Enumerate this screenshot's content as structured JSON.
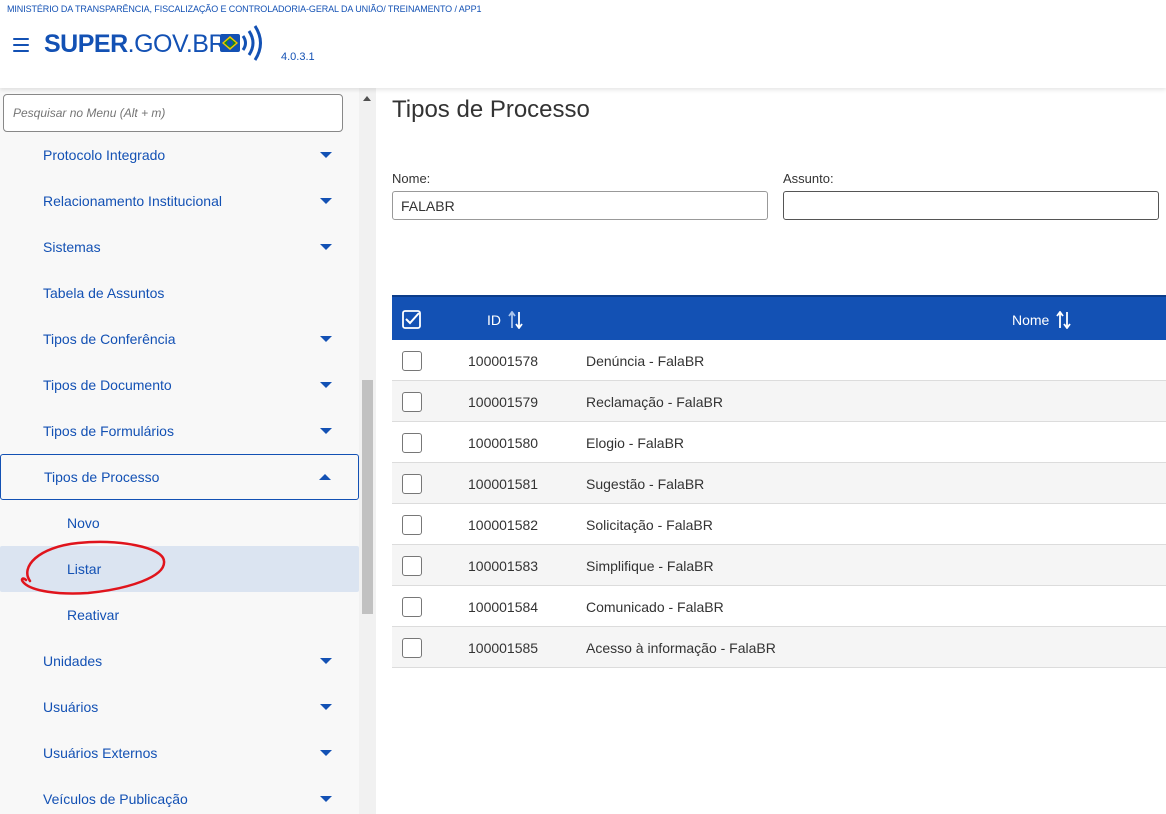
{
  "header": {
    "org_line": "MINISTÉRIO DA TRANSPARÊNCIA, FISCALIZAÇÃO E CONTROLADORIA-GERAL DA UNIÃO/ TREINAMENTO / APP1",
    "logo_bold": "SUPER",
    "logo_rest": ".GOV.BR",
    "version": "4.0.3.1",
    "hamburger_icon": "menu-icon",
    "accent_color": "#1351b4"
  },
  "sidebar": {
    "search_placeholder": "Pesquisar no Menu (Alt + m)",
    "items": [
      {
        "label": "Protocolo Integrado",
        "caret": "down"
      },
      {
        "label": "Relacionamento Institucional",
        "caret": "down"
      },
      {
        "label": "Sistemas",
        "caret": "down"
      },
      {
        "label": "Tabela de Assuntos",
        "caret": "none"
      },
      {
        "label": "Tipos de Conferência",
        "caret": "down"
      },
      {
        "label": "Tipos de Documento",
        "caret": "down"
      },
      {
        "label": "Tipos de Formulários",
        "caret": "down"
      },
      {
        "label": "Tipos de Processo",
        "caret": "up",
        "expanded": true
      },
      {
        "label": "Novo",
        "sub": true
      },
      {
        "label": "Listar",
        "sub": true,
        "active": true
      },
      {
        "label": "Reativar",
        "sub": true
      },
      {
        "label": "Unidades",
        "caret": "down"
      },
      {
        "label": "Usuários",
        "caret": "down"
      },
      {
        "label": "Usuários Externos",
        "caret": "down"
      },
      {
        "label": "Veículos de Publicação",
        "caret": "down"
      }
    ]
  },
  "main": {
    "title": "Tipos de Processo",
    "nome_label": "Nome:",
    "nome_value": "FALABR",
    "assunto_label": "Assunto:",
    "assunto_value": "",
    "table": {
      "col_id": "ID",
      "col_nome": "Nome",
      "header_color": "#1351b4",
      "rows": [
        {
          "id": "100001578",
          "nome": "Denúncia - FalaBR"
        },
        {
          "id": "100001579",
          "nome": "Reclamação - FalaBR"
        },
        {
          "id": "100001580",
          "nome": "Elogio - FalaBR"
        },
        {
          "id": "100001581",
          "nome": "Sugestão - FalaBR"
        },
        {
          "id": "100001582",
          "nome": "Solicitação - FalaBR"
        },
        {
          "id": "100001583",
          "nome": "Simplifique - FalaBR"
        },
        {
          "id": "100001584",
          "nome": "Comunicado - FalaBR"
        },
        {
          "id": "100001585",
          "nome": "Acesso à informação - FalaBR"
        }
      ]
    }
  },
  "annotation": {
    "color": "#e0141c",
    "shape": "hand-drawn-circle"
  }
}
